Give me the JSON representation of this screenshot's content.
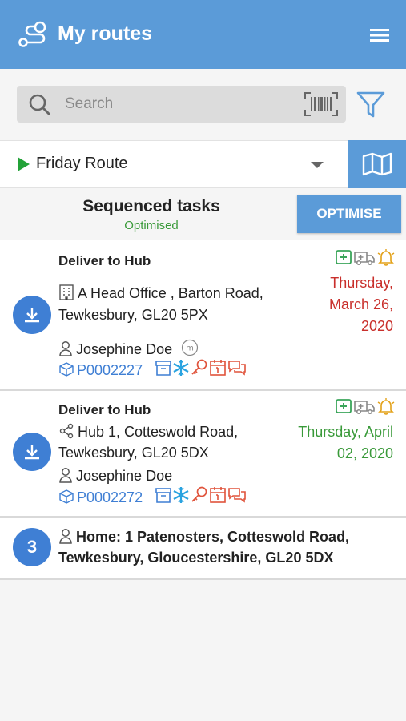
{
  "header": {
    "title": "My routes"
  },
  "search": {
    "placeholder": "Search"
  },
  "route": {
    "name": "Friday Route"
  },
  "sequence": {
    "title": "Sequenced tasks",
    "status": "Optimised",
    "optimise_label": "OPTIMISE"
  },
  "colors": {
    "primary": "#5b9bd8",
    "accent_blue": "#3f7fd4",
    "date_red": "#c9302c",
    "date_green": "#3a9a3a",
    "status_green": "#3a9a3a"
  },
  "tasks": [
    {
      "title": "Deliver to Hub",
      "address_line1": "A Head Office , Barton Road,",
      "address_line2": "Tewkesbury, GL20 5PX",
      "contact": "Josephine Doe",
      "reference": "P0002227",
      "date_line1": "Thursday,",
      "date_line2": "March 26,",
      "date_line3": "2020",
      "icons": [
        "download-icon",
        "building-icon",
        "person-icon",
        "m-badge-icon",
        "box-icon",
        "archive-icon",
        "snowflake-icon",
        "key-icon",
        "calendar-icon",
        "chat-icon",
        "medical-icon",
        "ambulance-icon",
        "bell-icon"
      ]
    },
    {
      "title": "Deliver to Hub",
      "address_line1": "Hub 1, Cotteswold Road,",
      "address_line2": "Tewkesbury, GL20 5DX",
      "contact": "Josephine Doe",
      "reference": "P0002272",
      "date_line1": "Thursday, April",
      "date_line2": "02, 2020",
      "icons": [
        "download-icon",
        "share-icon",
        "person-icon",
        "box-icon",
        "archive-icon",
        "snowflake-icon",
        "key-icon",
        "calendar-icon",
        "chat-icon",
        "medical-icon",
        "ambulance-icon",
        "bell-icon"
      ]
    },
    {
      "number": "3",
      "address_line1": "Home: 1 Patenosters, Cotteswold Road,",
      "address_line2": "Tewkesbury, Gloucestershire, GL20 5DX",
      "icons": [
        "person-icon"
      ]
    }
  ]
}
